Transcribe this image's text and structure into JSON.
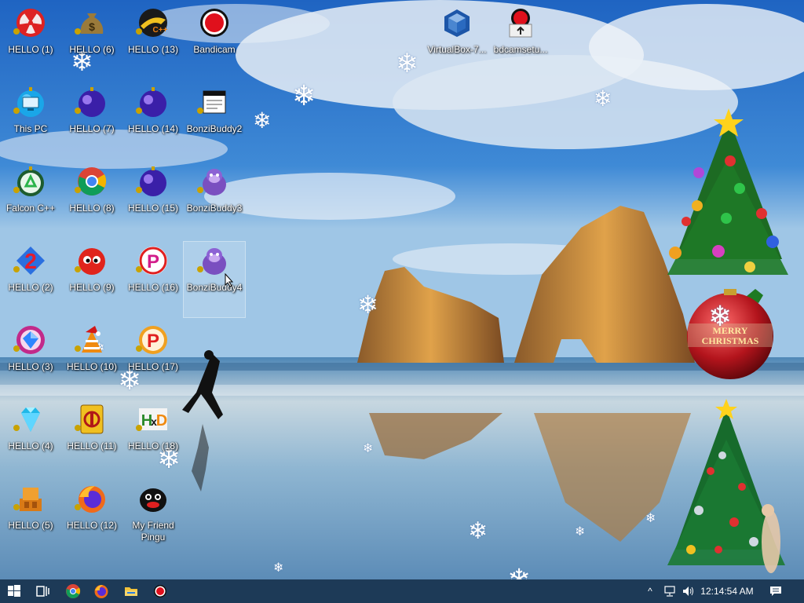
{
  "desktop": {
    "icons": [
      {
        "label": "HELLO (1)",
        "icon": "radiation-icon"
      },
      {
        "label": "This PC",
        "icon": "this-pc-icon"
      },
      {
        "label": "Falcon C++",
        "icon": "recycle-ornament-icon"
      },
      {
        "label": "HELLO (2)",
        "icon": "number-2-icon"
      },
      {
        "label": "HELLO (3)",
        "icon": "gem-ring-icon"
      },
      {
        "label": "HELLO (4)",
        "icon": "diamond-icon"
      },
      {
        "label": "HELLO (5)",
        "icon": "blocks-icon"
      },
      {
        "label": "HELLO (6)",
        "icon": "money-bag-icon"
      },
      {
        "label": "HELLO (7)",
        "icon": "purple-ornament-icon"
      },
      {
        "label": "HELLO (8)",
        "icon": "chrome-icon"
      },
      {
        "label": "HELLO (9)",
        "icon": "red-fuzzy-icon"
      },
      {
        "label": "HELLO (10)",
        "icon": "vlc-santa-icon"
      },
      {
        "label": "HELLO (11)",
        "icon": "mahjong-tile-icon"
      },
      {
        "label": "HELLO (12)",
        "icon": "firefox-icon"
      },
      {
        "label": "HELLO (13)",
        "icon": "cpp-ball-icon"
      },
      {
        "label": "HELLO (14)",
        "icon": "purple-ornament-icon"
      },
      {
        "label": "HELLO (15)",
        "icon": "purple-ornament-icon"
      },
      {
        "label": "HELLO (16)",
        "icon": "p-ball-icon"
      },
      {
        "label": "HELLO (17)",
        "icon": "p-ball-icon"
      },
      {
        "label": "HELLO (18)",
        "icon": "hxd-icon"
      },
      {
        "label": "My Friend Pingu",
        "icon": "penguin-icon"
      },
      {
        "label": "Bandicam",
        "icon": "bandicam-icon"
      },
      {
        "label": "BonziBuddy2",
        "icon": "file-icon"
      },
      {
        "label": "BonziBuddy3",
        "icon": "bonzi-gorilla-icon"
      },
      {
        "label": "BonziBuddy4",
        "icon": "bonzi-gorilla-icon"
      },
      {
        "label": "VirtualBox-7...",
        "icon": "virtualbox-icon"
      },
      {
        "label": "bdcamsetu...",
        "icon": "bdcam-setup-icon"
      }
    ],
    "ornament_text": "MERRY CHRISTMAS"
  },
  "taskbar": {
    "pinned": [
      {
        "name": "start-button",
        "icon": "windows-logo-icon"
      },
      {
        "name": "task-view-button",
        "icon": "task-view-icon"
      },
      {
        "name": "chrome-taskbar-button",
        "icon": "chrome-icon"
      },
      {
        "name": "firefox-taskbar-button",
        "icon": "firefox-icon"
      },
      {
        "name": "file-explorer-button",
        "icon": "folder-icon"
      },
      {
        "name": "bandicam-taskbar-button",
        "icon": "bandicam-icon"
      }
    ],
    "tray": {
      "chevron": "^",
      "icons": [
        "network-icon",
        "speaker-icon"
      ],
      "clock": "12:14:54 AM",
      "notification_icon": "action-center-icon"
    }
  },
  "colors": {
    "taskbar": "#1d3a57",
    "sky_top": "#1f64c2",
    "sea": "#6a9fc4",
    "label_text": "#ffffff"
  }
}
